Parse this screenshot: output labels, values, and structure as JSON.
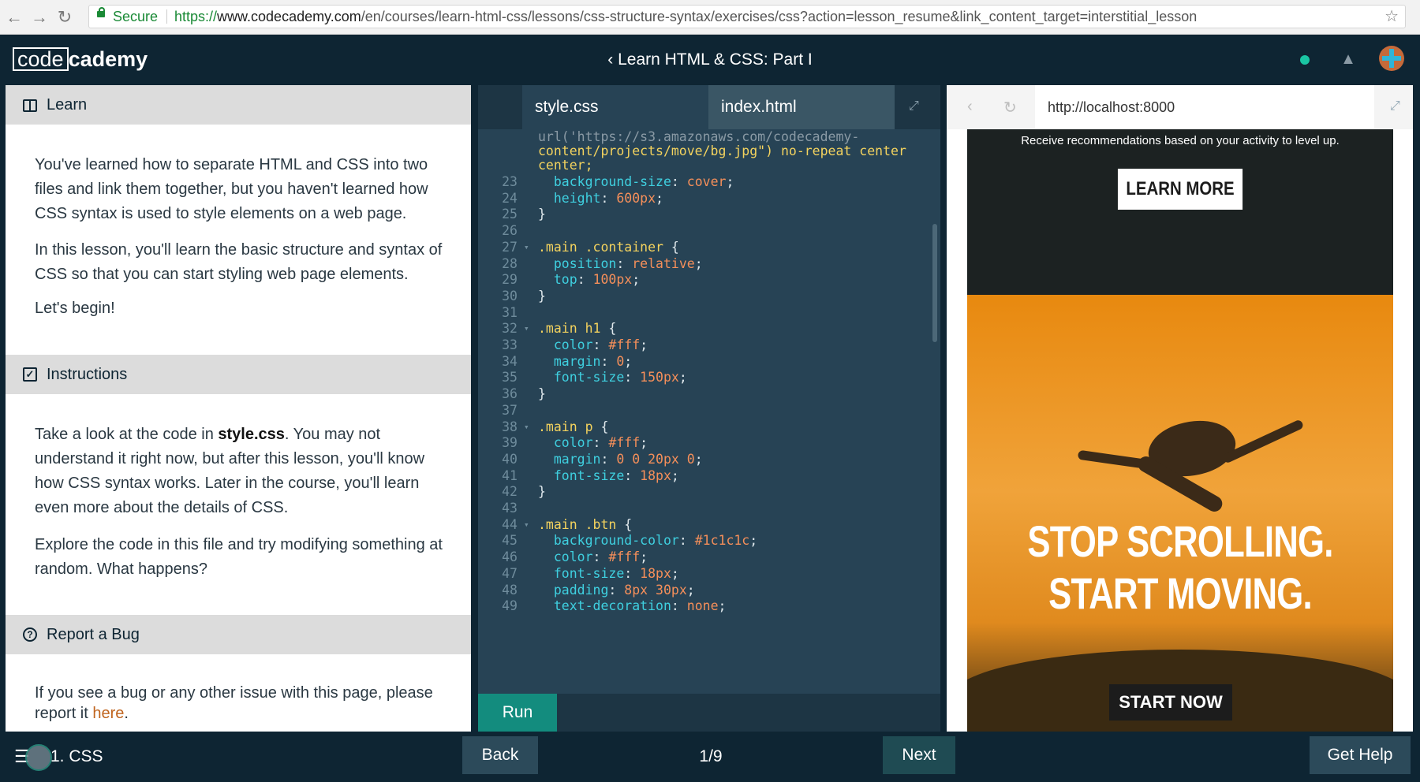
{
  "browser": {
    "secure_label": "Secure",
    "url_scheme": "https://",
    "url_host": "www.codecademy.com",
    "url_path": "/en/courses/learn-html-css/lessons/css-structure-syntax/exercises/css?action=lesson_resume&link_content_target=interstitial_lesson",
    "back_glyph": "←",
    "forward_glyph": "→",
    "reload_glyph": "↻",
    "star_glyph": "☆"
  },
  "app": {
    "logo_boxed": "code",
    "logo_rest": "cademy",
    "course_title": "‹ Learn HTML & CSS: Part I",
    "bell_glyph": "🔔"
  },
  "learn": {
    "header": "Learn",
    "p1": "You've learned how to separate HTML and CSS into two files and link them together, but you haven't learned how CSS syntax is used to style elements on a web page.",
    "p2": "In this lesson, you'll learn the basic structure and syntax of CSS so that you can start styling web page elements.",
    "p3": "Let's begin!"
  },
  "instructions": {
    "header": "Instructions",
    "p1_pre": "Take a look at the code in ",
    "p1_bold": "style.css",
    "p1_post": ". You may not understand it right now, but after this lesson, you'll know how CSS syntax works. Later in the course, you'll learn even more about the details of CSS.",
    "p2": "Explore the code in this file and try modifying something at random. What happens?"
  },
  "report": {
    "header": "Report a Bug",
    "text_pre": "If you see a bug or any other issue with this page, please report it ",
    "link": "here",
    "text_post": "."
  },
  "editor": {
    "tabs": [
      "style.css",
      "index.html"
    ],
    "run_label": "Run",
    "partial_lines": [
      "url('https://s3.amazonaws.com/codecademy-",
      "content/projects/move/bg.jpg\") no-repeat center",
      "center;"
    ],
    "lines": [
      {
        "n": "23",
        "fold": false,
        "parts": [
          [
            "  ",
            "punc"
          ],
          [
            "background-size",
            "prop"
          ],
          [
            ": ",
            "punc"
          ],
          [
            "cover",
            "val"
          ],
          [
            ";",
            "punc"
          ]
        ]
      },
      {
        "n": "24",
        "fold": false,
        "parts": [
          [
            "  ",
            "punc"
          ],
          [
            "height",
            "prop"
          ],
          [
            ": ",
            "punc"
          ],
          [
            "600px",
            "val"
          ],
          [
            ";",
            "punc"
          ]
        ]
      },
      {
        "n": "25",
        "fold": false,
        "parts": [
          [
            "}",
            "punc"
          ]
        ]
      },
      {
        "n": "26",
        "fold": false,
        "parts": []
      },
      {
        "n": "27",
        "fold": true,
        "parts": [
          [
            ".main .container",
            "sel"
          ],
          [
            " {",
            "punc"
          ]
        ]
      },
      {
        "n": "28",
        "fold": false,
        "parts": [
          [
            "  ",
            "punc"
          ],
          [
            "position",
            "prop"
          ],
          [
            ": ",
            "punc"
          ],
          [
            "relative",
            "val"
          ],
          [
            ";",
            "punc"
          ]
        ]
      },
      {
        "n": "29",
        "fold": false,
        "parts": [
          [
            "  ",
            "punc"
          ],
          [
            "top",
            "prop"
          ],
          [
            ": ",
            "punc"
          ],
          [
            "100px",
            "val"
          ],
          [
            ";",
            "punc"
          ]
        ]
      },
      {
        "n": "30",
        "fold": false,
        "parts": [
          [
            "}",
            "punc"
          ]
        ]
      },
      {
        "n": "31",
        "fold": false,
        "parts": []
      },
      {
        "n": "32",
        "fold": true,
        "parts": [
          [
            ".main h1",
            "sel"
          ],
          [
            " {",
            "punc"
          ]
        ]
      },
      {
        "n": "33",
        "fold": false,
        "parts": [
          [
            "  ",
            "punc"
          ],
          [
            "color",
            "prop"
          ],
          [
            ": ",
            "punc"
          ],
          [
            "#fff",
            "val"
          ],
          [
            ";",
            "punc"
          ]
        ]
      },
      {
        "n": "34",
        "fold": false,
        "parts": [
          [
            "  ",
            "punc"
          ],
          [
            "margin",
            "prop"
          ],
          [
            ": ",
            "punc"
          ],
          [
            "0",
            "val"
          ],
          [
            ";",
            "punc"
          ]
        ]
      },
      {
        "n": "35",
        "fold": false,
        "parts": [
          [
            "  ",
            "punc"
          ],
          [
            "font-size",
            "prop"
          ],
          [
            ": ",
            "punc"
          ],
          [
            "150px",
            "val"
          ],
          [
            ";",
            "punc"
          ]
        ]
      },
      {
        "n": "36",
        "fold": false,
        "parts": [
          [
            "}",
            "punc"
          ]
        ]
      },
      {
        "n": "37",
        "fold": false,
        "parts": []
      },
      {
        "n": "38",
        "fold": true,
        "parts": [
          [
            ".main p",
            "sel"
          ],
          [
            " {",
            "punc"
          ]
        ]
      },
      {
        "n": "39",
        "fold": false,
        "parts": [
          [
            "  ",
            "punc"
          ],
          [
            "color",
            "prop"
          ],
          [
            ": ",
            "punc"
          ],
          [
            "#fff",
            "val"
          ],
          [
            ";",
            "punc"
          ]
        ]
      },
      {
        "n": "40",
        "fold": false,
        "parts": [
          [
            "  ",
            "punc"
          ],
          [
            "margin",
            "prop"
          ],
          [
            ": ",
            "punc"
          ],
          [
            "0 0 20px 0",
            "val"
          ],
          [
            ";",
            "punc"
          ]
        ]
      },
      {
        "n": "41",
        "fold": false,
        "parts": [
          [
            "  ",
            "punc"
          ],
          [
            "font-size",
            "prop"
          ],
          [
            ": ",
            "punc"
          ],
          [
            "18px",
            "val"
          ],
          [
            ";",
            "punc"
          ]
        ]
      },
      {
        "n": "42",
        "fold": false,
        "parts": [
          [
            "}",
            "punc"
          ]
        ]
      },
      {
        "n": "43",
        "fold": false,
        "parts": []
      },
      {
        "n": "44",
        "fold": true,
        "parts": [
          [
            ".main .btn",
            "sel"
          ],
          [
            " {",
            "punc"
          ]
        ]
      },
      {
        "n": "45",
        "fold": false,
        "parts": [
          [
            "  ",
            "punc"
          ],
          [
            "background-color",
            "prop"
          ],
          [
            ": ",
            "punc"
          ],
          [
            "#1c1c1c",
            "val"
          ],
          [
            ";",
            "punc"
          ]
        ]
      },
      {
        "n": "46",
        "fold": false,
        "parts": [
          [
            "  ",
            "punc"
          ],
          [
            "color",
            "prop"
          ],
          [
            ": ",
            "punc"
          ],
          [
            "#fff",
            "val"
          ],
          [
            ";",
            "punc"
          ]
        ]
      },
      {
        "n": "47",
        "fold": false,
        "parts": [
          [
            "  ",
            "punc"
          ],
          [
            "font-size",
            "prop"
          ],
          [
            ": ",
            "punc"
          ],
          [
            "18px",
            "val"
          ],
          [
            ";",
            "punc"
          ]
        ]
      },
      {
        "n": "48",
        "fold": false,
        "parts": [
          [
            "  ",
            "punc"
          ],
          [
            "padding",
            "prop"
          ],
          [
            ": ",
            "punc"
          ],
          [
            "8px 30px",
            "val"
          ],
          [
            ";",
            "punc"
          ]
        ]
      },
      {
        "n": "49",
        "fold": false,
        "parts": [
          [
            "  ",
            "punc"
          ],
          [
            "text-decoration",
            "prop"
          ],
          [
            ": ",
            "punc"
          ],
          [
            "none",
            "val"
          ],
          [
            ";",
            "punc"
          ]
        ]
      }
    ]
  },
  "preview": {
    "url": "http://localhost:8000",
    "top_text": "Receive recommendations based on your activity to level up.",
    "learn_more": "LEARN MORE",
    "headline": "STOP SCROLLING. START MOVING.",
    "start_now": "START NOW",
    "back_glyph": "‹",
    "reload_glyph": "↻"
  },
  "footer": {
    "menu_glyph": "☰",
    "lesson": "1. CSS",
    "back": "Back",
    "progress": "1/9",
    "next": "Next",
    "help": "Get Help"
  },
  "colors": {
    "navy": "#0e2533",
    "editor_bg": "#274355",
    "run_green": "#138c7e",
    "link_orange": "#c0651f",
    "hero_orange": "#e8890f"
  }
}
